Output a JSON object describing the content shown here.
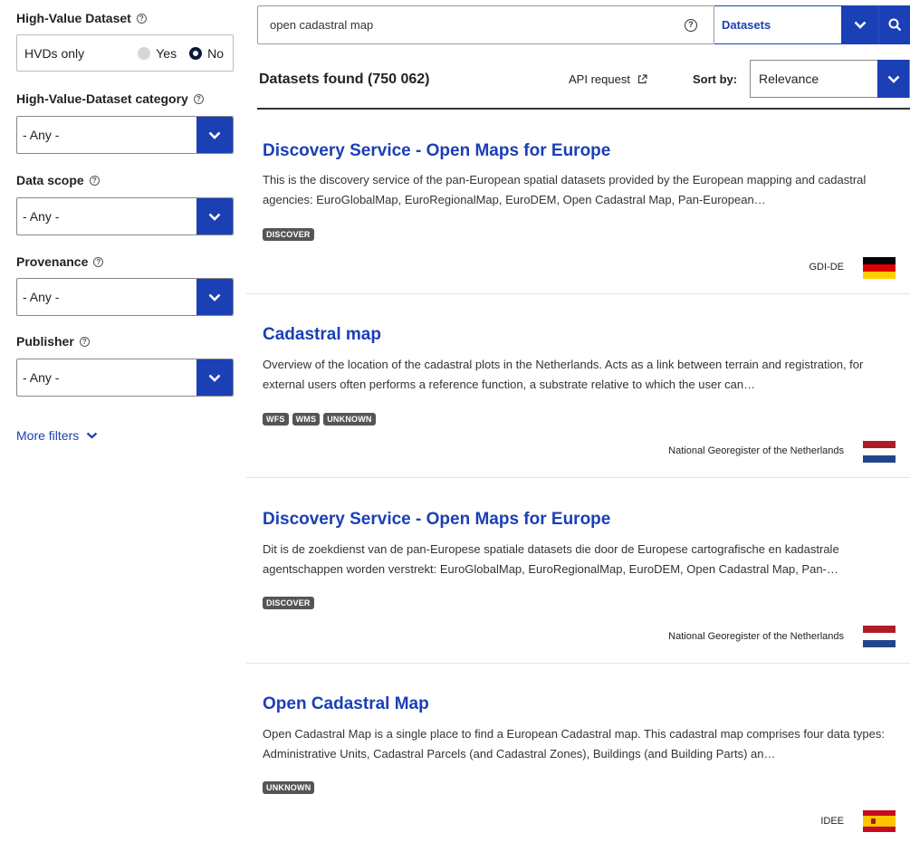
{
  "filters": {
    "hvd": {
      "label": "High-Value Dataset",
      "field_label": "HVDs only",
      "yes_label": "Yes",
      "no_label": "No",
      "selected": "No"
    },
    "hvd_category": {
      "label": "High-Value-Dataset category",
      "value": "- Any -"
    },
    "data_scope": {
      "label": "Data scope",
      "value": "- Any -"
    },
    "provenance": {
      "label": "Provenance",
      "value": "- Any -"
    },
    "publisher": {
      "label": "Publisher",
      "value": "- Any -"
    },
    "more_filters_label": "More filters"
  },
  "search": {
    "query": "open cadastral map",
    "type_value": "Datasets"
  },
  "results_header": {
    "count_text": "Datasets found (750 062)",
    "api_label": "API request",
    "sort_label": "Sort by:",
    "sort_value": "Relevance"
  },
  "results": [
    {
      "title": "Discovery Service - Open Maps for Europe",
      "description": "This is the discovery service of the pan-European spatial datasets provided by the European mapping and cadastral agencies: EuroGlobalMap, EuroRegionalMap, EuroDEM, Open Cadastral Map, Pan-European…",
      "tags": [
        "DISCOVER"
      ],
      "publisher": "GDI-DE",
      "flag": "germany"
    },
    {
      "title": "Cadastral map",
      "description": "Overview of the location of the cadastral plots in the Netherlands. Acts as a link between terrain and registration, for external users often performs a reference function, a substrate relative to which the user can…",
      "tags": [
        "WFS",
        "WMS",
        "UNKNOWN"
      ],
      "publisher": "National Georegister of the Netherlands",
      "flag": "netherlands"
    },
    {
      "title": "Discovery Service - Open Maps for Europe",
      "description": "Dit is de zoekdienst van de pan-Europese spatiale datasets die door de Europese cartografische en kadastrale agentschappen worden verstrekt: EuroGlobalMap, EuroRegionalMap, EuroDEM, Open Cadastral Map, Pan-…",
      "tags": [
        "DISCOVER"
      ],
      "publisher": "National Georegister of the Netherlands",
      "flag": "netherlands"
    },
    {
      "title": "Open Cadastral Map",
      "description": "Open Cadastral Map is a single place to find a European Cadastral map. This cadastral map comprises four data types: Administrative Units, Cadastral Parcels (and Cadastral Zones), Buildings (and Building Parts) an…",
      "tags": [
        "UNKNOWN"
      ],
      "publisher": "IDEE",
      "flag": "spain"
    }
  ],
  "colors": {
    "accent": "#1b3fb5",
    "tag_bg": "#555555"
  }
}
